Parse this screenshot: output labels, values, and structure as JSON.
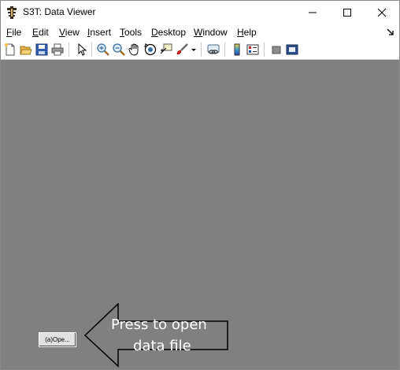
{
  "window": {
    "title": "S3T: Data Viewer"
  },
  "menu": {
    "items": [
      {
        "underline": "F",
        "rest": "ile"
      },
      {
        "underline": "E",
        "rest": "dit"
      },
      {
        "underline": "V",
        "rest": "iew"
      },
      {
        "underline": "I",
        "rest": "nsert"
      },
      {
        "underline": "T",
        "rest": "ools"
      },
      {
        "underline": "D",
        "rest": "esktop"
      },
      {
        "underline": "W",
        "rest": "indow"
      },
      {
        "underline": "H",
        "rest": "elp"
      }
    ]
  },
  "toolbar": {
    "icons": [
      "new-file-icon",
      "open-folder-icon",
      "save-icon",
      "print-icon",
      "pointer-icon",
      "zoom-in-icon",
      "zoom-out-icon",
      "pan-hand-icon",
      "rotate-3d-icon",
      "data-cursor-icon",
      "brush-icon",
      "link-plot-icon",
      "colorbar-icon",
      "legend-icon",
      "hide-plot-tools-icon",
      "show-plot-tools-icon"
    ]
  },
  "main": {
    "open_button_label": "(a)Ope...",
    "hint_line1": "Press to open",
    "hint_line2": "data file"
  },
  "colors": {
    "workspace": "#808080",
    "hint_text": "#ffffff"
  }
}
